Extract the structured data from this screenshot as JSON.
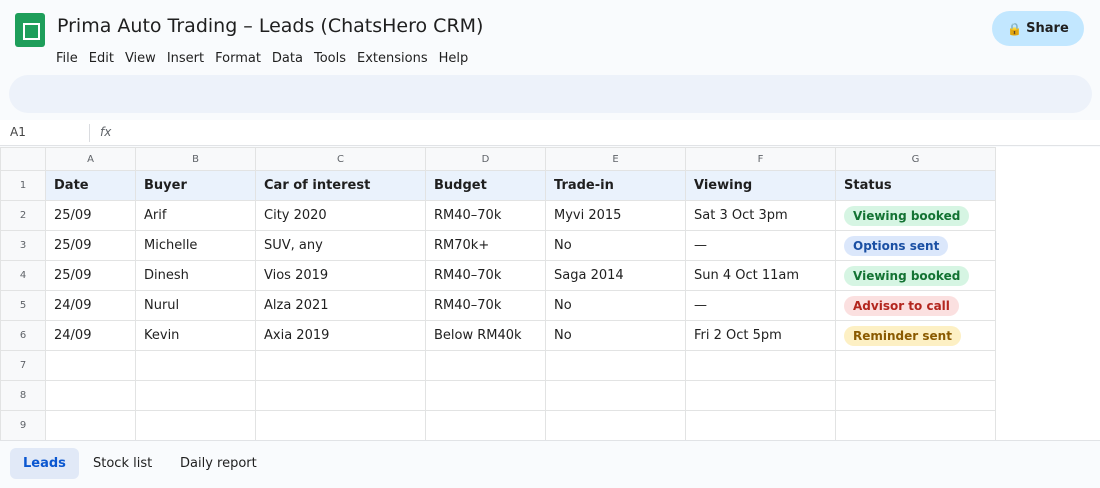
{
  "app": {
    "title": "Prima Auto Trading – Leads (ChatsHero CRM)",
    "share_label": "Share",
    "menu": [
      "File",
      "Edit",
      "View",
      "Insert",
      "Format",
      "Data",
      "Tools",
      "Extensions",
      "Help"
    ]
  },
  "formula_bar": {
    "cell_ref": "A1",
    "fx_label": "fx"
  },
  "sheet": {
    "columns": [
      "A",
      "B",
      "C",
      "D",
      "E",
      "F",
      "G"
    ],
    "rows": [
      "1",
      "2",
      "3",
      "4",
      "5",
      "6",
      "7",
      "8",
      "9"
    ],
    "headers": [
      "Date",
      "Buyer",
      "Car of interest",
      "Budget",
      "Trade-in",
      "Viewing",
      "Status"
    ],
    "data": [
      [
        "25/09",
        "Arif",
        "City 2020",
        "RM40–70k",
        "Myvi 2015",
        "Sat 3 Oct 3pm",
        "Viewing booked"
      ],
      [
        "25/09",
        "Michelle",
        "SUV, any",
        "RM70k+",
        "No",
        "—",
        "Options sent"
      ],
      [
        "25/09",
        "Dinesh",
        "Vios 2019",
        "RM40–70k",
        "Saga 2014",
        "Sun 4 Oct 11am",
        "Viewing booked"
      ],
      [
        "24/09",
        "Nurul",
        "Alza 2021",
        "RM40–70k",
        "No",
        "—",
        "Advisor to call"
      ],
      [
        "24/09",
        "Kevin",
        "Axia 2019",
        "Below RM40k",
        "No",
        "Fri 2 Oct 5pm",
        "Reminder sent"
      ]
    ],
    "status_colors": {
      "Viewing booked": {
        "bg": "#d6f5e3",
        "fg": "#137333"
      },
      "Options sent": {
        "bg": "#dbe7fb",
        "fg": "#1a4fa3"
      },
      "Advisor to call": {
        "bg": "#fbe0e0",
        "fg": "#b3261e"
      },
      "Reminder sent": {
        "bg": "#fdf0c4",
        "fg": "#8a5a00"
      }
    }
  },
  "tabs": [
    "Leads",
    "Stock list",
    "Daily report"
  ],
  "active_tab": "Leads"
}
